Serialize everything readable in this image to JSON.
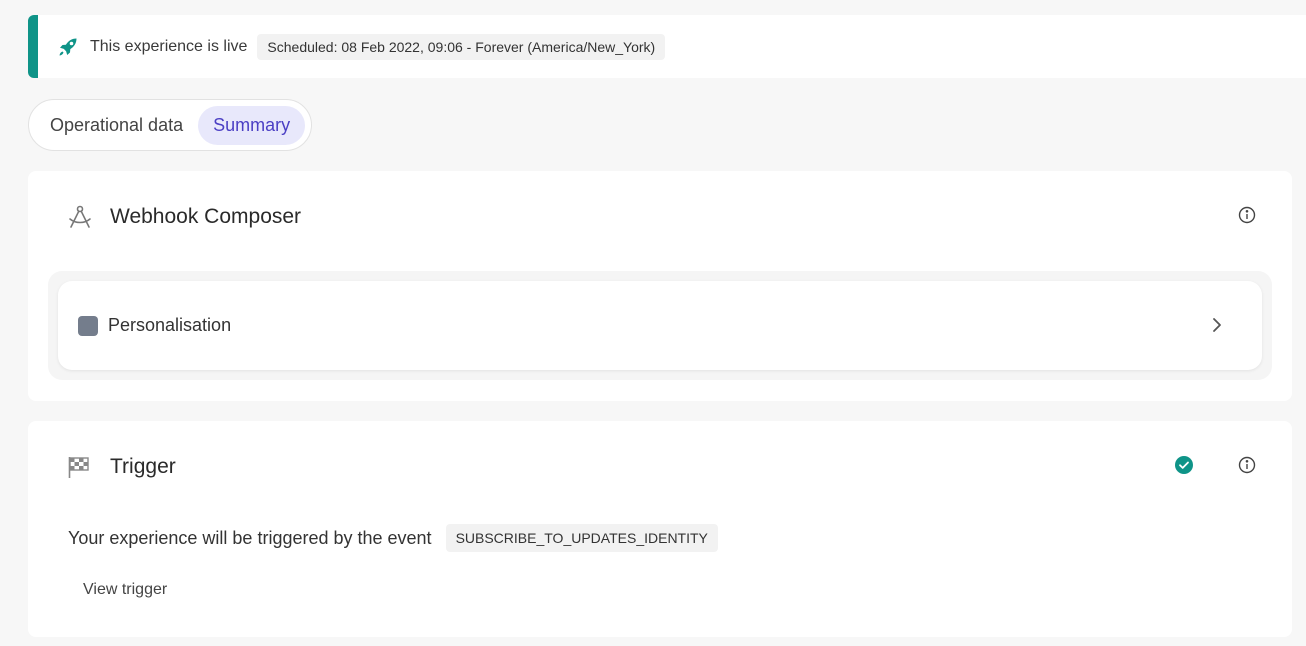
{
  "banner": {
    "icon": "rocket-icon",
    "live_text": "This experience is live",
    "schedule": "Scheduled: 08 Feb 2022, 09:06 - Forever (America/New_York)",
    "accent_color": "#0f9488"
  },
  "tabs": [
    {
      "label": "Operational data",
      "active": false
    },
    {
      "label": "Summary",
      "active": true
    }
  ],
  "webhook_card": {
    "icon": "compass-icon",
    "title": "Webhook Composer",
    "info_icon": "info-icon",
    "item": {
      "label": "Personalisation",
      "swatch_color": "#747d8c",
      "chevron": "chevron-right-icon"
    }
  },
  "trigger_card": {
    "icon": "flag-icon",
    "title": "Trigger",
    "status_icon": "check-circle-icon",
    "status_color": "#0f9488",
    "info_icon": "info-icon",
    "description": "Your experience will be triggered by the event",
    "event": "SUBSCRIBE_TO_UPDATES_IDENTITY",
    "view_link": "View trigger"
  }
}
